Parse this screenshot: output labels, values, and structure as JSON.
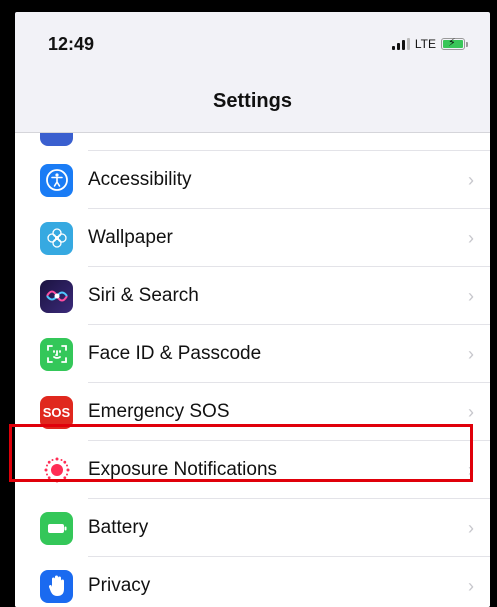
{
  "status_bar": {
    "time": "12:49",
    "network": "LTE"
  },
  "nav": {
    "title": "Settings"
  },
  "settings_items": [
    {
      "label": "Accessibility",
      "icon": "accessibility-icon",
      "color": "#1a7cf5"
    },
    {
      "label": "Wallpaper",
      "icon": "wallpaper-flower-icon",
      "color": "#36a9e1"
    },
    {
      "label": "Siri & Search",
      "icon": "siri-icon",
      "color": "#2a1c5e"
    },
    {
      "label": "Face ID & Passcode",
      "icon": "face-id-icon",
      "color": "#34c759"
    },
    {
      "label": "Emergency SOS",
      "icon": "sos-icon",
      "color": "#e0281e",
      "icon_text": "SOS"
    },
    {
      "label": "Exposure Notifications",
      "icon": "exposure-icon",
      "color": "#ffffff"
    },
    {
      "label": "Battery",
      "icon": "battery-icon",
      "color": "#34c759"
    },
    {
      "label": "Privacy",
      "icon": "privacy-hand-icon",
      "color": "#1a6af0"
    }
  ],
  "highlight_color": "#e0000a"
}
